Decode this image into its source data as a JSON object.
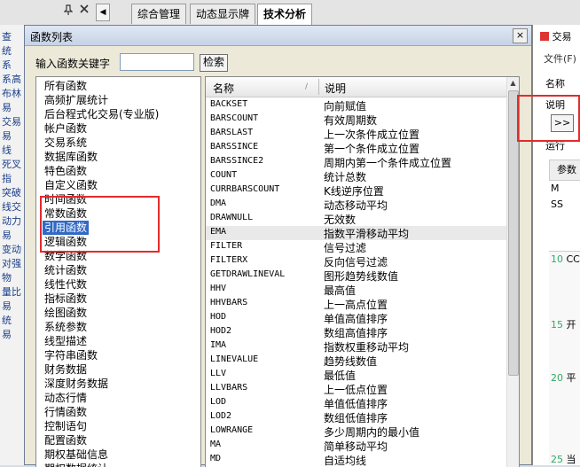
{
  "tabbar": {
    "pin_glyph": "q",
    "close_glyph": "✖",
    "tabs": [
      {
        "label": "综合管理"
      },
      {
        "label": "动态显示牌"
      },
      {
        "label": "技术分析"
      }
    ]
  },
  "left_strip": {
    "lines": [
      "查",
      "统",
      "系",
      "系高",
      "布林",
      "易",
      "交易",
      "易",
      "线",
      "死叉",
      "指",
      "突破",
      "线交",
      "动力",
      "易",
      "变动",
      "对强",
      "物",
      "量比",
      "易",
      "统",
      "易"
    ]
  },
  "right_window": {
    "title": "交易",
    "menu": "文件(F)",
    "name_label": "名称",
    "desc_label": "说明",
    "expand_btn": ">>",
    "run_label": "运行",
    "param_label": "参数",
    "params": [
      "M",
      "SS"
    ],
    "code_lines": [
      {
        "ln": "10",
        "text": "CC"
      },
      {
        "ln": "15",
        "text": "开"
      },
      {
        "ln": "20",
        "text": "平"
      },
      {
        "ln": "25",
        "text": "当"
      }
    ]
  },
  "dialog": {
    "title": "函数列表",
    "close_label": "×",
    "keyword_label": "输入函数关键字",
    "keyword_value": "",
    "search_label": "检索",
    "categories": [
      "所有函数",
      "高频扩展统计",
      "后台程式化交易(专业版)",
      "帐户函数",
      "交易系统",
      "数据库函数",
      "特色函数",
      "自定义函数",
      "时间函数",
      "常数函数",
      "引用函数",
      "逻辑函数",
      "数学函数",
      "统计函数",
      "线性代数",
      "指标函数",
      "绘图函数",
      "系统参数",
      "线型描述",
      "字符串函数",
      "财务数据",
      "深度财务数据",
      "动态行情",
      "行情函数",
      "控制语句",
      "配置函数",
      "期权基础信息",
      "期权数据统计"
    ],
    "selected_category": 10,
    "table": {
      "col_name": "名称",
      "col_desc": "说明",
      "rows": [
        {
          "name": "BACKSET",
          "desc": "向前赋值"
        },
        {
          "name": "BARSCOUNT",
          "desc": "有效周期数"
        },
        {
          "name": "BARSLAST",
          "desc": "上一次条件成立位置"
        },
        {
          "name": "BARSSINCE",
          "desc": "第一个条件成立位置"
        },
        {
          "name": "BARSSINCE2",
          "desc": "周期内第一个条件成立位置"
        },
        {
          "name": "COUNT",
          "desc": "统计总数"
        },
        {
          "name": "CURRBARSCOUNT",
          "desc": "K线逆序位置"
        },
        {
          "name": "DMA",
          "desc": "动态移动平均"
        },
        {
          "name": "DRAWNULL",
          "desc": "无效数"
        },
        {
          "name": "EMA",
          "desc": "指数平滑移动平均"
        },
        {
          "name": "FILTER",
          "desc": "信号过滤"
        },
        {
          "name": "FILTERX",
          "desc": "反向信号过滤"
        },
        {
          "name": "GETDRAWLINEVAL",
          "desc": "图形趋势线数值"
        },
        {
          "name": "HHV",
          "desc": "最高值"
        },
        {
          "name": "HHVBARS",
          "desc": "上一高点位置"
        },
        {
          "name": "HOD",
          "desc": "单值高值排序"
        },
        {
          "name": "HOD2",
          "desc": "数组高值排序"
        },
        {
          "name": "IMA",
          "desc": "指数权重移动平均"
        },
        {
          "name": "LINEVALUE",
          "desc": "趋势线数值"
        },
        {
          "name": "LLV",
          "desc": "最低值"
        },
        {
          "name": "LLVBARS",
          "desc": "上一低点位置"
        },
        {
          "name": "LOD",
          "desc": "单值低值排序"
        },
        {
          "name": "LOD2",
          "desc": "数组低值排序"
        },
        {
          "name": "LOWRANGE",
          "desc": "多少周期内的最小值"
        },
        {
          "name": "MA",
          "desc": "简单移动平均"
        },
        {
          "name": "MD",
          "desc": "自适均线"
        }
      ],
      "highlighted_row": 9
    }
  },
  "colors": {
    "highlight_box": "#e32b2b",
    "selection": "#3169c6"
  }
}
